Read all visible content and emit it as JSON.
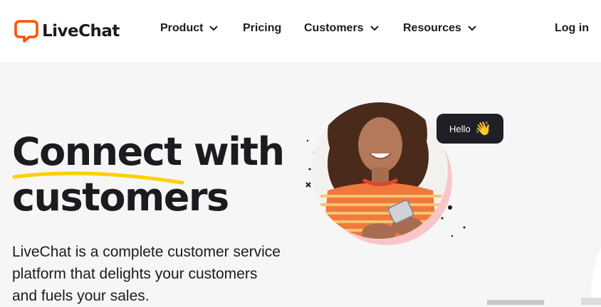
{
  "brand": {
    "name": "LiveChat",
    "accent": "#ff5100"
  },
  "nav": {
    "items": [
      {
        "label": "Product",
        "has_dropdown": true
      },
      {
        "label": "Pricing",
        "has_dropdown": false
      },
      {
        "label": "Customers",
        "has_dropdown": true
      },
      {
        "label": "Resources",
        "has_dropdown": true
      }
    ],
    "login_label": "Log in"
  },
  "hero": {
    "title_line1_word1": "Connect",
    "title_line1_word2": "with",
    "title_line2": "customers",
    "underline_color": "#ffd000",
    "description": "LiveChat is a complete customer service platform that delights your customers and fuels your sales.",
    "chat_bubble": {
      "text": "Hello",
      "emoji": "👋"
    }
  }
}
